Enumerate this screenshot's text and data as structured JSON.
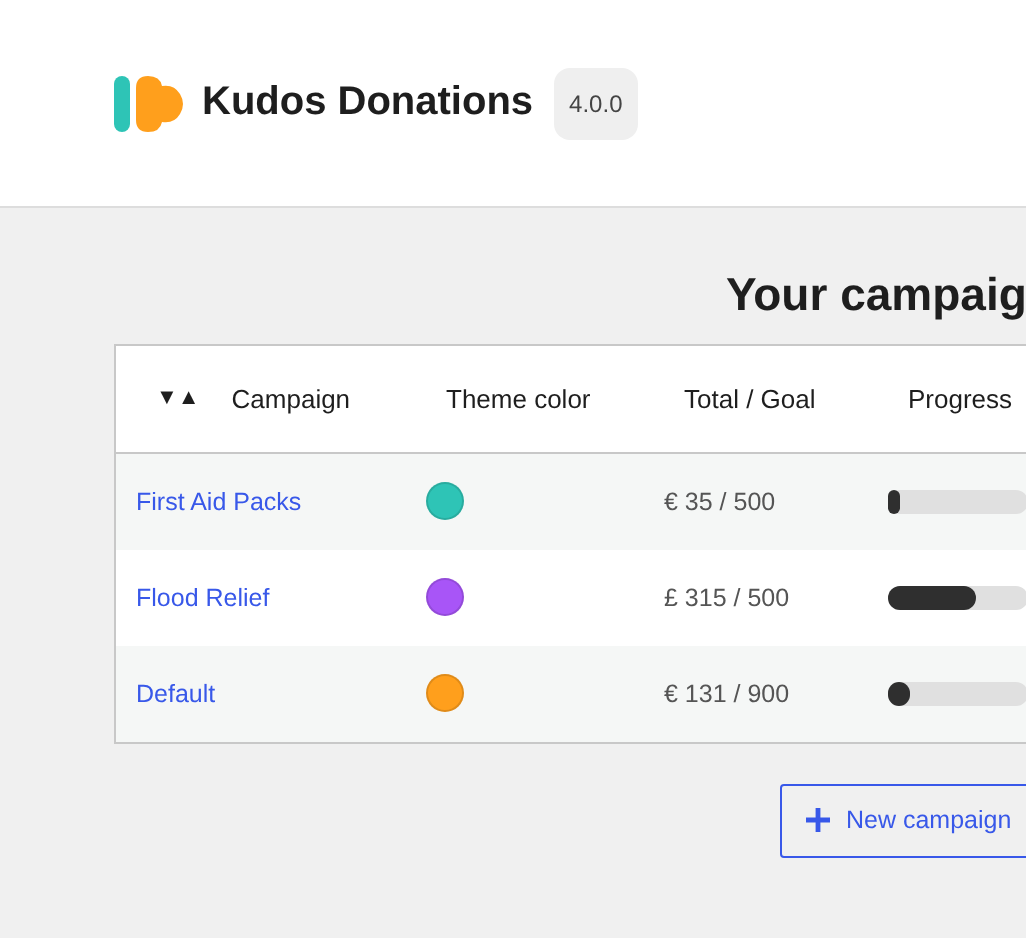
{
  "header": {
    "title": "Kudos Donations",
    "version": "4.0.0"
  },
  "heading": "Your campaig",
  "table": {
    "sort_icon": "▼▲",
    "columns": [
      "Campaign",
      "Theme color",
      "Total / Goal",
      "Progress"
    ],
    "rows": [
      {
        "name": "First Aid Packs",
        "color": "#2ec4b6",
        "total": "€ 35 / 500",
        "level": 0.07
      },
      {
        "name": "Flood Relief",
        "color": "#a855f7",
        "total": "£ 315 / 500",
        "level": 0.63
      },
      {
        "name": "Default",
        "color": "#ff9f1c",
        "total": "€ 131 / 900",
        "level": 0.15
      }
    ]
  },
  "new_button": {
    "label": "New campaign"
  }
}
